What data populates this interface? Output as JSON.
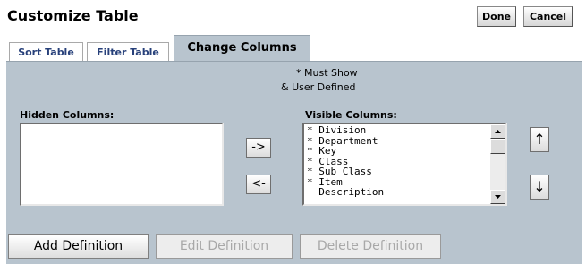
{
  "header": {
    "title": "Customize Table",
    "done_label": "Done",
    "cancel_label": "Cancel"
  },
  "tabs": [
    {
      "label": "Sort Table",
      "active": false
    },
    {
      "label": "Filter Table",
      "active": false
    },
    {
      "label": "Change Columns",
      "active": true
    }
  ],
  "legend": {
    "must_show": "* Must Show",
    "user_defined": "& User Defined"
  },
  "hidden_columns": {
    "label": "Hidden Columns:",
    "items": []
  },
  "visible_columns": {
    "label": "Visible Columns:",
    "items": [
      "* Division",
      "* Department",
      "* Key",
      "* Class",
      "* Sub Class",
      "* Item",
      "  Description"
    ]
  },
  "move_buttons": {
    "to_visible": "->",
    "to_hidden": "<-",
    "up": "↑",
    "down": "↓"
  },
  "footer": {
    "add_label": "Add Definition",
    "edit_label": "Edit Definition",
    "delete_label": "Delete Definition"
  },
  "colors": {
    "panel": "#b8c4ce",
    "tab_text": "#27407a",
    "disabled_text": "#a8a8a8"
  }
}
